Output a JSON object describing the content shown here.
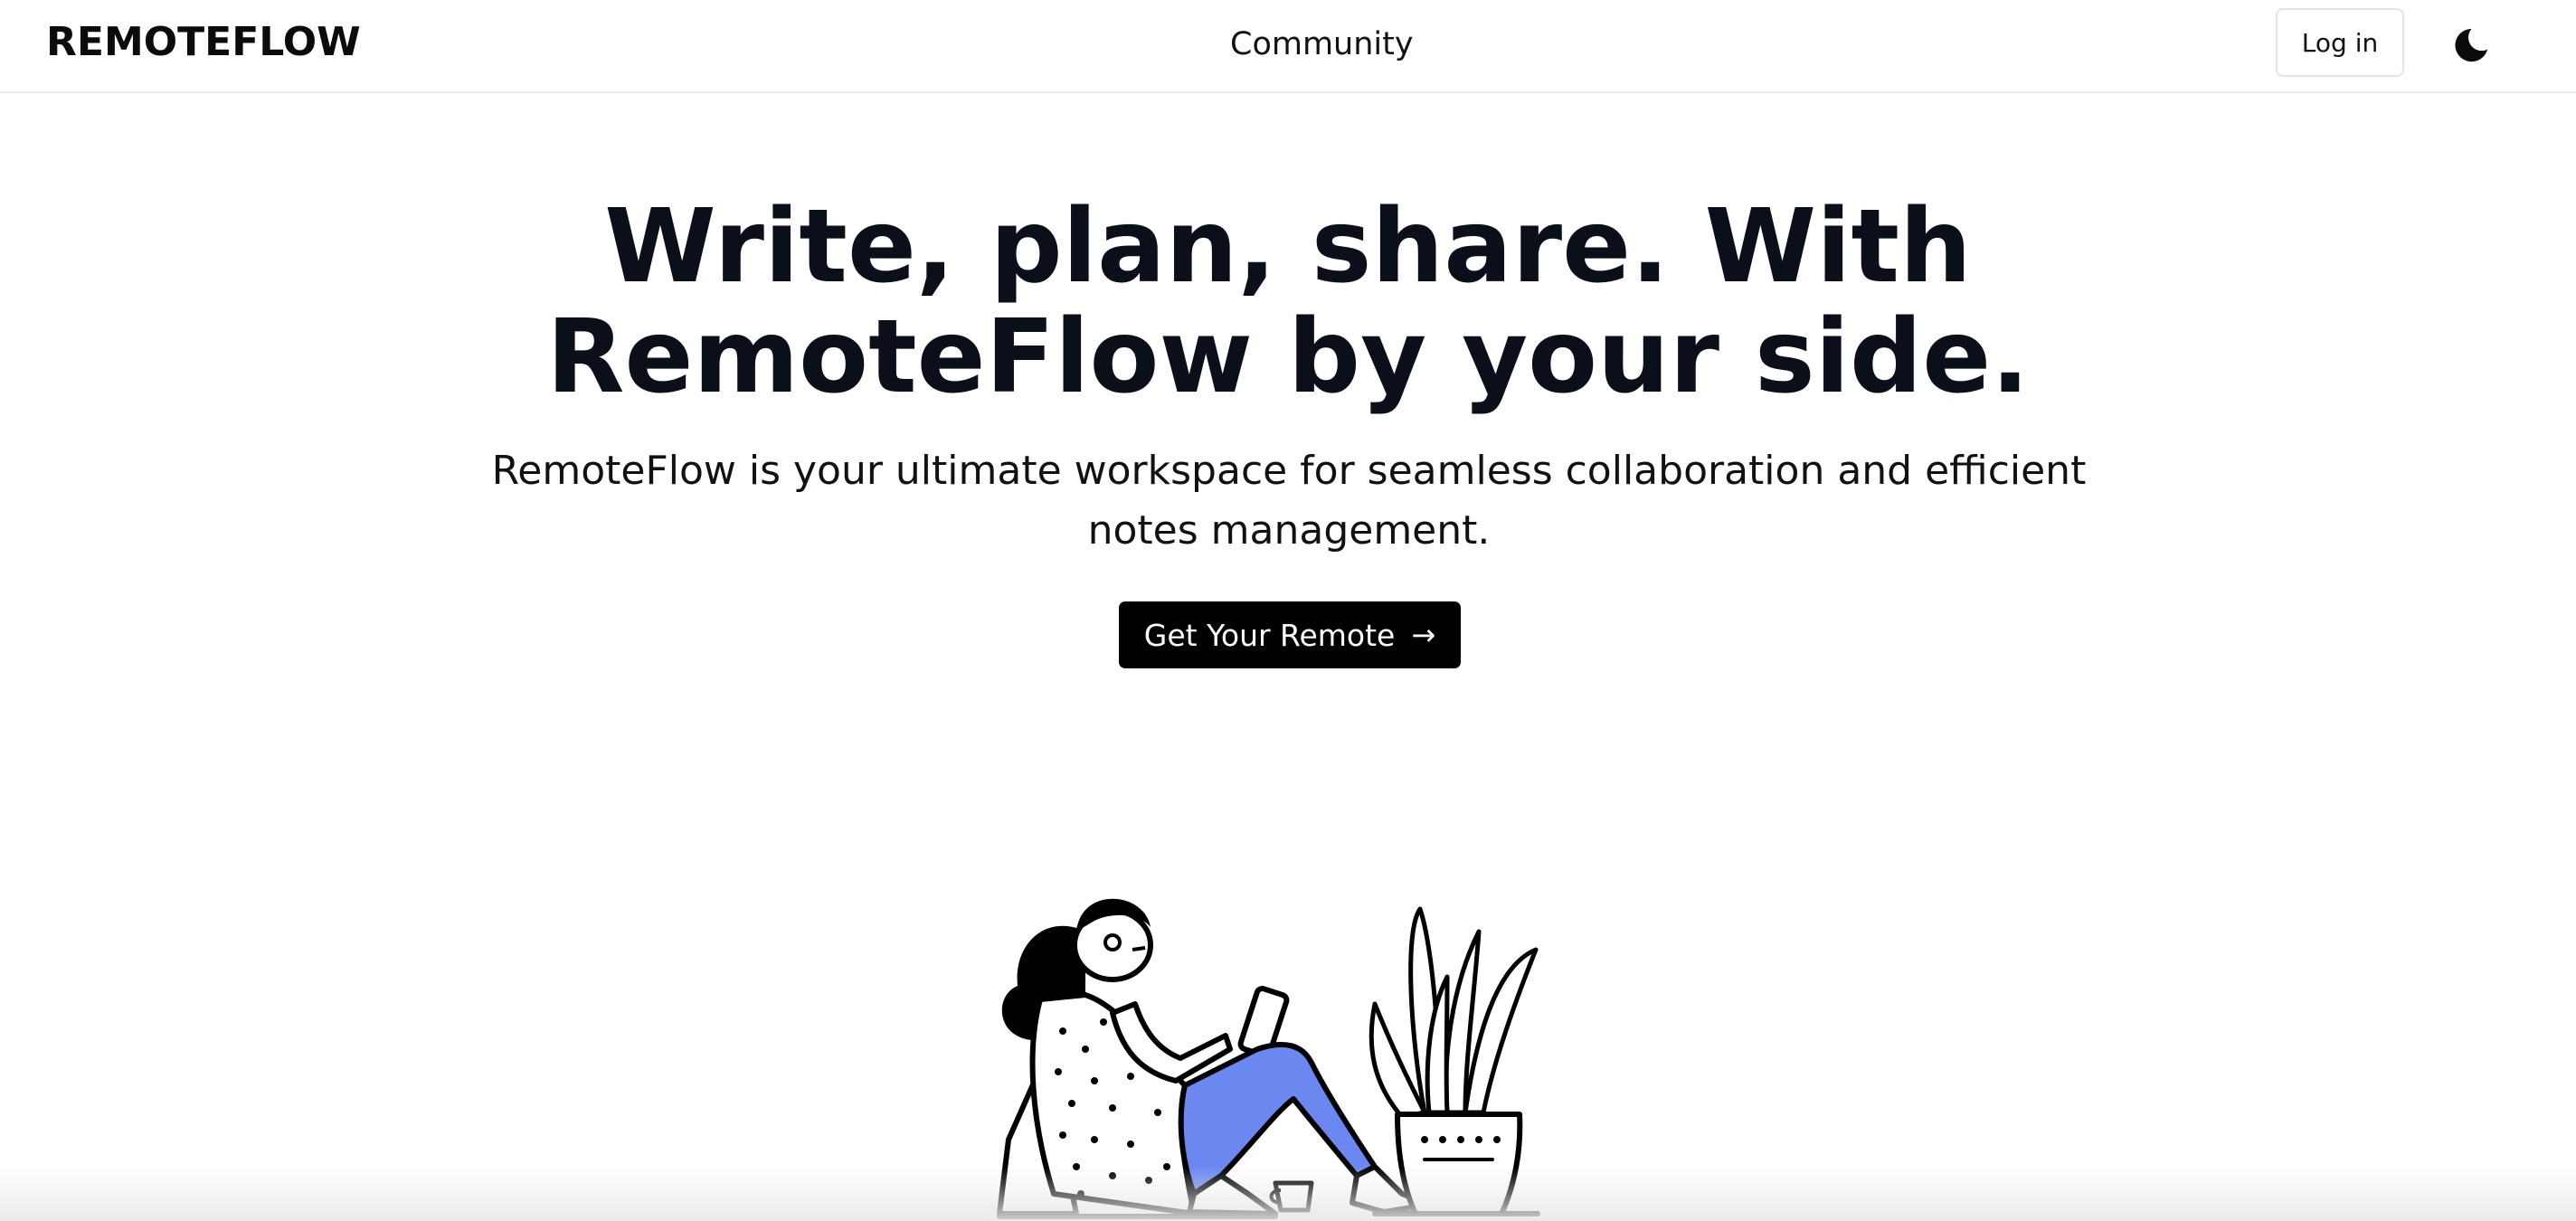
{
  "header": {
    "brand": "REMOTEFLOW",
    "nav_link": "Community",
    "login_label": "Log in",
    "theme_icon": "moon-icon"
  },
  "hero": {
    "title_line1": "Write, plan, share. With",
    "title_line2": "RemoteFlow by your side.",
    "subtitle": "RemoteFlow is your ultimate workspace for seamless collaboration and efficient notes management.",
    "cta_label": "Get Your Remote",
    "cta_icon": "arrow-right-icon"
  },
  "illustration": {
    "name": "woman-reading-illustration",
    "accent_color": "#6b87f0"
  },
  "colors": {
    "text": "#0b0f1a",
    "button_bg": "#000000",
    "border": "#e9e9ec"
  }
}
